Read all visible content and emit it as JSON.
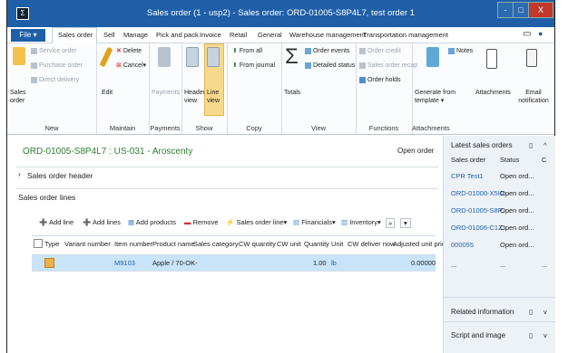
{
  "window": {
    "title": "Sales order (1 - usp2) - Sales order: ORD-01005-S8P4L7, test order 1",
    "app_icon": "Σ",
    "controls": [
      "-",
      "□",
      "X"
    ]
  },
  "menu": {
    "file": "File",
    "tabs": [
      "Sales order",
      "Sell",
      "Manage",
      "Pick and pack",
      "Invoice",
      "Retail",
      "General",
      "Warehouse management",
      "Transportation management"
    ]
  },
  "ribbon": {
    "new": {
      "label": "New",
      "sales_order": "Sales order",
      "service_order": "Service order",
      "purchase_order": "Purchase order",
      "direct_delivery": "Direct delivery"
    },
    "maintain": {
      "label": "Maintain",
      "edit": "Edit",
      "delete": "Delete",
      "cancel": "Cancel▾"
    },
    "payments": {
      "label": "Payments",
      "payments": "Payments"
    },
    "show": {
      "label": "Show",
      "header_view": "Header view",
      "line_view": "Line view"
    },
    "copy": {
      "label": "Copy",
      "from_all": "From all",
      "from_journal": "From journal"
    },
    "view": {
      "label": "View",
      "totals": "Totals",
      "order_events": "Order events",
      "detailed_status": "Detailed status"
    },
    "functions": {
      "label": "Functions",
      "order_credit": "Order credit",
      "sales_order_recap": "Sales order recap",
      "order_holds": "Order holds"
    },
    "attachments": {
      "label": "Attachments",
      "generate_from_template": "Generate from template ▾",
      "notes": "Notes",
      "attachments": "Attachments",
      "email_notification": "Email notification"
    }
  },
  "content": {
    "heading": "ORD-01005-S8P4L7 : US-031 - Aroscenty",
    "status": "Open order",
    "sales_order_header": "Sales order header",
    "sales_order_lines": "Sales order lines",
    "toolbar": [
      "Add line",
      "Add lines",
      "Add products",
      "Remove",
      "Sales order line▾",
      "Financials▾",
      "Inventory▾",
      "»"
    ],
    "columns": [
      "Type",
      "Variant number",
      "Item number",
      "Product name",
      "Sales category",
      "CW quantity",
      "CW unit",
      "Quantity",
      "Unit",
      "CW deliver now",
      "Adjusted unit price"
    ],
    "rows": [
      {
        "item": "M9103",
        "product": "Apple / 70-OK-",
        "quantity": "1.00",
        "unit": "lb",
        "price": "0.00000"
      }
    ]
  },
  "sidebar": {
    "latest_title": "Latest sales orders",
    "col_order": "Sales order",
    "col_status": "Status",
    "col_more": "C",
    "orders": [
      {
        "order": "CPR Test1",
        "status": "Open ord..."
      },
      {
        "order": "ORD-01000-X5I0...",
        "status": "Open ord..."
      },
      {
        "order": "ORD-01005-S8P...",
        "status": "Open ord..."
      },
      {
        "order": "ORD-01006-C1Z...",
        "status": "Open ord..."
      },
      {
        "order": "000055",
        "status": "Open ord..."
      }
    ],
    "ellipsis": [
      "...",
      "...",
      "..."
    ],
    "related": "Related information",
    "script": "Script and image"
  },
  "colors": {
    "title_bar": "#1e5fa8",
    "accent_green": "#2e7d32",
    "link": "#1f5fa8",
    "selected_row": "#c9e4f8"
  }
}
